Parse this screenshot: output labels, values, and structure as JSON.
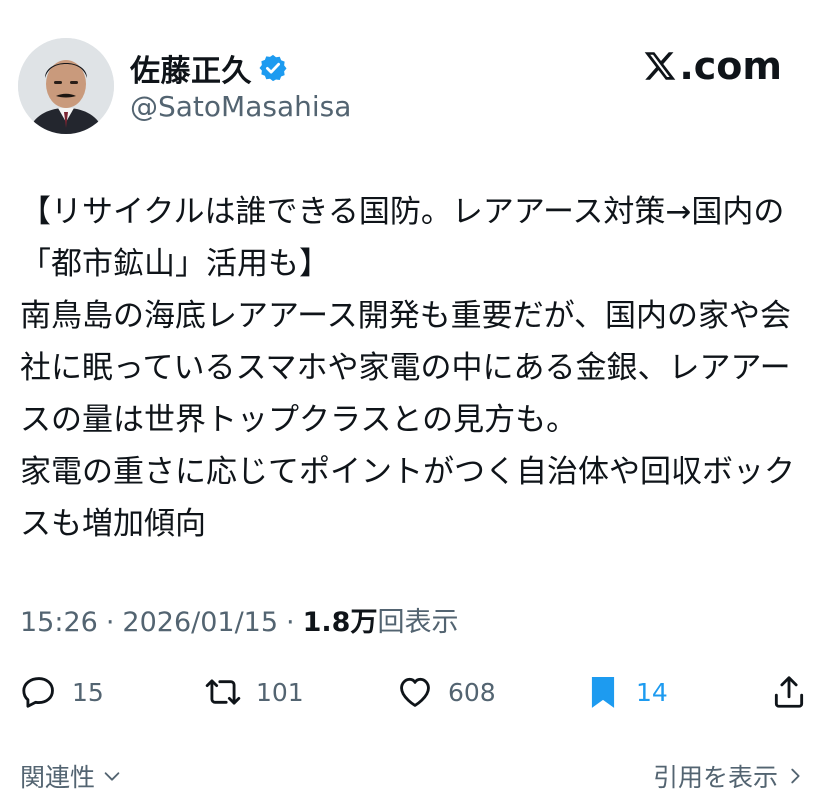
{
  "author": {
    "display_name": "佐藤正久",
    "handle": "@SatoMasahisa",
    "verified_icon": "verified-badge-icon"
  },
  "brand": {
    "label": ".com",
    "logo_icon": "x-logo-icon"
  },
  "tweet": {
    "text": "【リサイクルは誰できる国防。レアアース対策→国内の「都市鉱山」活用も】\n南鳥島の海底レアアース開発も重要だが、国内の家や会社に眠っているスマホや家電の中にある金銀、レアアースの量は世界トップクラスとの見方も。\n家電の重さに応じてポイントがつく自治体や回収ボックスも増加傾向"
  },
  "meta": {
    "time": "15:26",
    "separator": "·",
    "date": "2026/01/15",
    "views_count": "1.8万",
    "views_label": "回表示"
  },
  "actions": {
    "replies": "15",
    "reposts": "101",
    "likes": "608",
    "bookmarks": "14"
  },
  "footer": {
    "related_label": "関連性",
    "quotes_label": "引用を表示"
  },
  "colors": {
    "text": "#0f1419",
    "secondary": "#536471",
    "accent": "#1d9bf0"
  }
}
